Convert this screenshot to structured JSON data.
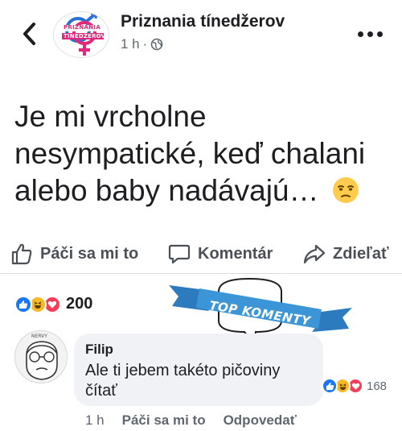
{
  "header": {
    "page_name": "Priznania tínedžerov",
    "time": "1 h",
    "separator": "·",
    "logo_text_top": "PRIZNANIA",
    "logo_text_bottom": "TÍNEDŽEROV"
  },
  "post": {
    "text": "Je mi vrcholne nesympatické, keď chalani alebo baby nadávajú…"
  },
  "actions": {
    "like": "Páči sa mi to",
    "comment": "Komentár",
    "share": "Zdieľať"
  },
  "reactions": {
    "count": "200"
  },
  "banner": {
    "text": "TOP KOMENTY"
  },
  "comment": {
    "author": "Filip",
    "text": "Ale ti jebem takéto pičoviny čítať",
    "reaction_count": "168",
    "time": "1 h",
    "like_label": "Páči sa mi to",
    "reply_label": "Odpovedať",
    "avatar_text": "NERVY"
  },
  "colors": {
    "like_blue": "#1877f2",
    "haha_yellow": "#f7b928",
    "love_red": "#f33e58",
    "banner_blue": "#3b95d6",
    "text_gray": "#606770"
  }
}
